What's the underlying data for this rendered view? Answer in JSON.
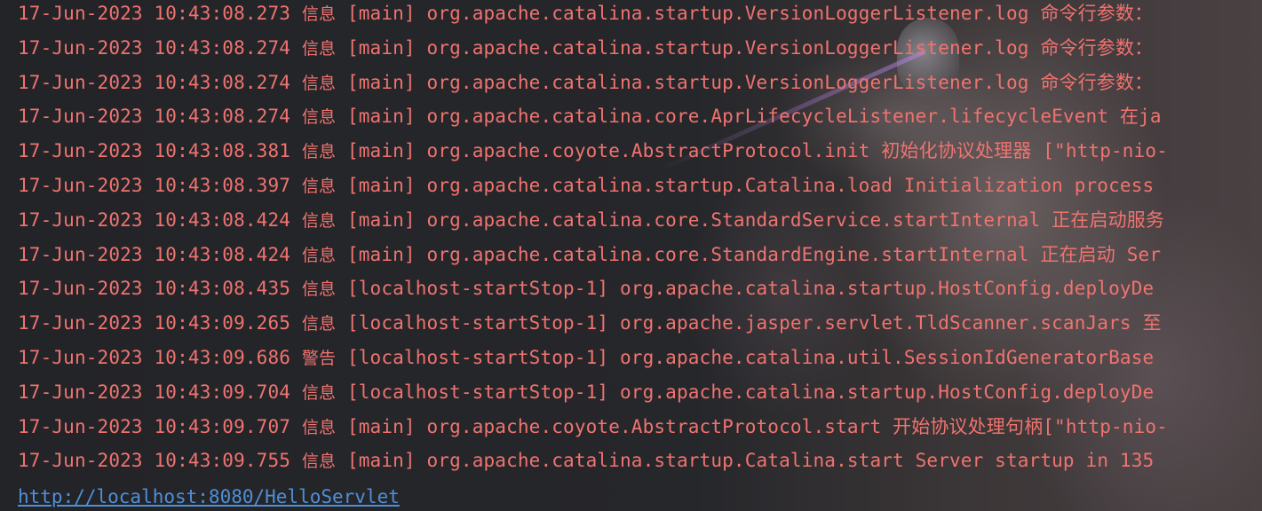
{
  "console": {
    "lines": [
      {
        "timestamp": "17-Jun-2023 10:43:08.273",
        "level": "信息",
        "thread": "[main]",
        "source": "org.apache.catalina.startup.VersionLoggerListener.log",
        "message": "命令行参数："
      },
      {
        "timestamp": "17-Jun-2023 10:43:08.274",
        "level": "信息",
        "thread": "[main]",
        "source": "org.apache.catalina.startup.VersionLoggerListener.log",
        "message": "命令行参数："
      },
      {
        "timestamp": "17-Jun-2023 10:43:08.274",
        "level": "信息",
        "thread": "[main]",
        "source": "org.apache.catalina.startup.VersionLoggerListener.log",
        "message": "命令行参数："
      },
      {
        "timestamp": "17-Jun-2023 10:43:08.274",
        "level": "信息",
        "thread": "[main]",
        "source": "org.apache.catalina.core.AprLifecycleListener.lifecycleEvent",
        "message": "在ja"
      },
      {
        "timestamp": "17-Jun-2023 10:43:08.381",
        "level": "信息",
        "thread": "[main]",
        "source": "org.apache.coyote.AbstractProtocol.init",
        "message": "初始化协议处理器 [\"http-nio-"
      },
      {
        "timestamp": "17-Jun-2023 10:43:08.397",
        "level": "信息",
        "thread": "[main]",
        "source": "org.apache.catalina.startup.Catalina.load",
        "message": "Initialization process"
      },
      {
        "timestamp": "17-Jun-2023 10:43:08.424",
        "level": "信息",
        "thread": "[main]",
        "source": "org.apache.catalina.core.StandardService.startInternal",
        "message": "正在启动服务"
      },
      {
        "timestamp": "17-Jun-2023 10:43:08.424",
        "level": "信息",
        "thread": "[main]",
        "source": "org.apache.catalina.core.StandardEngine.startInternal",
        "message": "正在启动 Ser"
      },
      {
        "timestamp": "17-Jun-2023 10:43:08.435",
        "level": "信息",
        "thread": "[localhost-startStop-1]",
        "source": "org.apache.catalina.startup.HostConfig.deployDe",
        "message": ""
      },
      {
        "timestamp": "17-Jun-2023 10:43:09.265",
        "level": "信息",
        "thread": "[localhost-startStop-1]",
        "source": "org.apache.jasper.servlet.TldScanner.scanJars",
        "message": "至"
      },
      {
        "timestamp": "17-Jun-2023 10:43:09.686",
        "level": "警告",
        "thread": "[localhost-startStop-1]",
        "source": "org.apache.catalina.util.SessionIdGeneratorBase",
        "message": ""
      },
      {
        "timestamp": "17-Jun-2023 10:43:09.704",
        "level": "信息",
        "thread": "[localhost-startStop-1]",
        "source": "org.apache.catalina.startup.HostConfig.deployDe",
        "message": ""
      },
      {
        "timestamp": "17-Jun-2023 10:43:09.707",
        "level": "信息",
        "thread": "[main]",
        "source": "org.apache.coyote.AbstractProtocol.start",
        "message": "开始协议处理句柄[\"http-nio-"
      },
      {
        "timestamp": "17-Jun-2023 10:43:09.755",
        "level": "信息",
        "thread": "[main]",
        "source": "org.apache.catalina.startup.Catalina.start",
        "message": "Server startup in 135"
      }
    ],
    "link": "http://localhost:8080/HelloServlet"
  },
  "colors": {
    "log_text": "#f0736f",
    "link": "#4f8fd8",
    "background": "#1e1f22"
  }
}
